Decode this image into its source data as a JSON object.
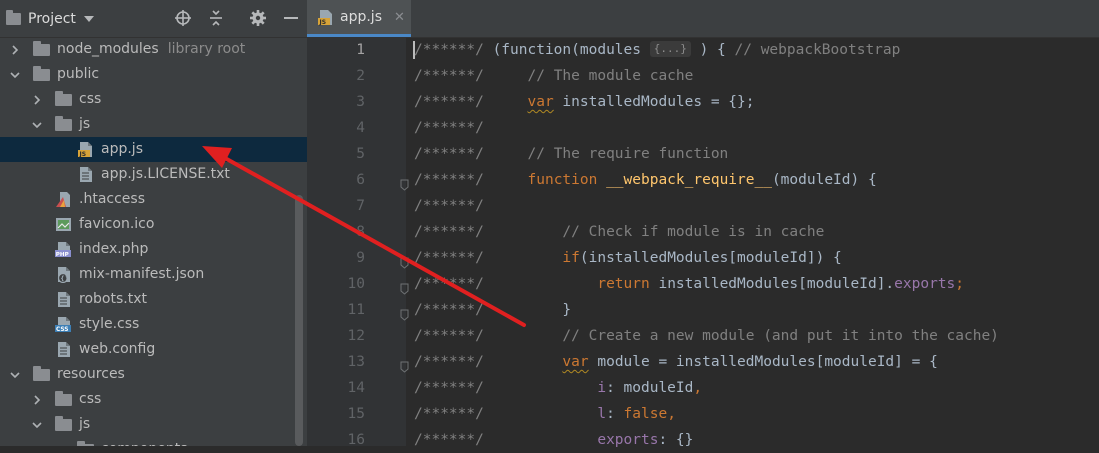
{
  "project_panel": {
    "title": "Project",
    "tools": [
      "locate-icon",
      "collapse-all-icon",
      "settings-icon",
      "hide-icon"
    ]
  },
  "tree": [
    {
      "label": "node_modules",
      "muted": "library root",
      "type": "folder",
      "expanded": false
    },
    {
      "label": "public",
      "type": "folder",
      "expanded": true
    },
    {
      "label": "css",
      "type": "folder",
      "expanded": false
    },
    {
      "label": "js",
      "type": "folder",
      "expanded": true
    },
    {
      "label": "app.js",
      "type": "js-file",
      "selected": true
    },
    {
      "label": "app.js.LICENSE.txt",
      "type": "text-file"
    },
    {
      "label": ".htaccess",
      "type": "htaccess-file"
    },
    {
      "label": "favicon.ico",
      "type": "image-file"
    },
    {
      "label": "index.php",
      "type": "php-file"
    },
    {
      "label": "mix-manifest.json",
      "type": "json-file"
    },
    {
      "label": "robots.txt",
      "type": "text-file"
    },
    {
      "label": "style.css",
      "type": "css-file"
    },
    {
      "label": "web.config",
      "type": "text-file"
    },
    {
      "label": "resources",
      "type": "folder",
      "expanded": true
    },
    {
      "label": "css",
      "type": "folder",
      "expanded": false
    },
    {
      "label": "js",
      "type": "folder",
      "expanded": true
    },
    {
      "label": "components",
      "type": "folder",
      "expanded": true
    }
  ],
  "editor": {
    "tab_label": "app.js",
    "fold_chip": "{...}",
    "lines": [
      {
        "n": "1",
        "p": "/******/ ",
        "segs": [
          [
            "p",
            "(function(modules "
          ],
          [
            "chip",
            ""
          ],
          [
            "p",
            " ) { "
          ],
          [
            "c",
            "// webpackBootstrap"
          ]
        ]
      },
      {
        "n": "2",
        "p": "/******/ ",
        "segs": [
          [
            "p",
            "    "
          ],
          [
            "c",
            "// The module cache"
          ]
        ]
      },
      {
        "n": "3",
        "p": "/******/ ",
        "segs": [
          [
            "p",
            "    "
          ],
          [
            "kq",
            "var"
          ],
          [
            "p",
            " installedModules = {};"
          ]
        ]
      },
      {
        "n": "4",
        "p": "/******/",
        "segs": []
      },
      {
        "n": "5",
        "p": "/******/ ",
        "segs": [
          [
            "p",
            "    "
          ],
          [
            "c",
            "// The require function"
          ]
        ]
      },
      {
        "n": "6",
        "p": "/******/ ",
        "segs": [
          [
            "p",
            "    "
          ],
          [
            "k",
            "function "
          ],
          [
            "f",
            "__webpack_require__"
          ],
          [
            "p",
            "(moduleId) {"
          ]
        ]
      },
      {
        "n": "7",
        "p": "/******/",
        "segs": []
      },
      {
        "n": "8",
        "p": "/******/ ",
        "segs": [
          [
            "p",
            "        "
          ],
          [
            "c",
            "// Check if module is in cache"
          ]
        ]
      },
      {
        "n": "9",
        "p": "/******/ ",
        "segs": [
          [
            "p",
            "        "
          ],
          [
            "k",
            "if"
          ],
          [
            "p",
            "(installedModules[moduleId]) {"
          ]
        ]
      },
      {
        "n": "10",
        "p": "/******/ ",
        "segs": [
          [
            "p",
            "            "
          ],
          [
            "k",
            "return"
          ],
          [
            "p",
            " installedModules[moduleId]."
          ],
          [
            "pr",
            "exports"
          ],
          [
            "k",
            ";"
          ]
        ]
      },
      {
        "n": "11",
        "p": "/******/ ",
        "segs": [
          [
            "p",
            "        }"
          ]
        ]
      },
      {
        "n": "12",
        "p": "/******/ ",
        "segs": [
          [
            "p",
            "        "
          ],
          [
            "c",
            "// Create a new module (and put it into the cache)"
          ]
        ]
      },
      {
        "n": "13",
        "p": "/******/ ",
        "segs": [
          [
            "p",
            "        "
          ],
          [
            "kq",
            "var"
          ],
          [
            "p",
            " module = installedModules[moduleId] = {"
          ]
        ]
      },
      {
        "n": "14",
        "p": "/******/ ",
        "segs": [
          [
            "p",
            "            "
          ],
          [
            "pr",
            "i"
          ],
          [
            "p",
            ": moduleId"
          ],
          [
            "k",
            ","
          ]
        ]
      },
      {
        "n": "15",
        "p": "/******/ ",
        "segs": [
          [
            "p",
            "            "
          ],
          [
            "pr",
            "l"
          ],
          [
            "p",
            ": "
          ],
          [
            "k",
            "false,"
          ]
        ]
      },
      {
        "n": "16",
        "p": "/******/ ",
        "segs": [
          [
            "p",
            "            "
          ],
          [
            "pr",
            "exports"
          ],
          [
            "p",
            ": {}"
          ]
        ]
      }
    ]
  },
  "colors": {
    "comment": "#808080",
    "keyword": "#cc7832",
    "function": "#ffc66d",
    "property": "#9876aa",
    "text": "#a9b7c6",
    "annotation_arrow": "#e02020"
  }
}
